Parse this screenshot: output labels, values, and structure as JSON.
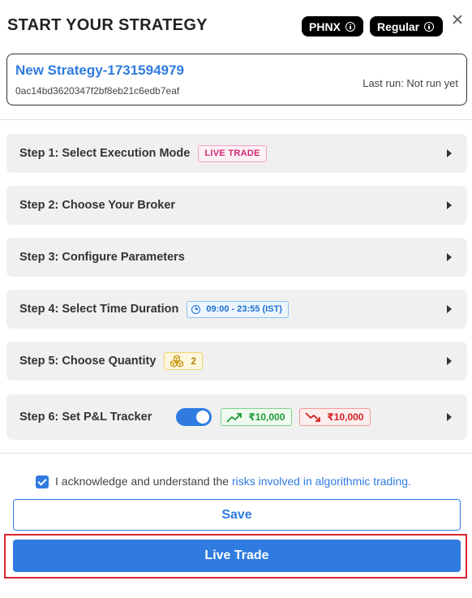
{
  "header": {
    "title": "START YOUR STRATEGY",
    "badges": [
      {
        "label": "PHNX",
        "icon": "info-icon"
      },
      {
        "label": "Regular",
        "icon": "info-icon"
      }
    ],
    "close_icon": "close-icon"
  },
  "strategy": {
    "name": "New Strategy-1731594979",
    "id": "0ac14bd3620347f2bf8eb21c6edb7eaf",
    "last_run": "Last run: Not run yet"
  },
  "steps": [
    {
      "label": "Step 1: Select Execution Mode",
      "tag": "LIVE TRADE"
    },
    {
      "label": "Step 2: Choose Your Broker"
    },
    {
      "label": "Step 3: Configure Parameters"
    },
    {
      "label": "Step 4: Select Time Duration",
      "tag": "09:00 - 23:55 (IST)",
      "tag_icon": "clock-icon"
    },
    {
      "label": "Step 5: Choose Quantity",
      "tag": "2",
      "tag_icon": "cubes-icon"
    },
    {
      "label": "Step 6: Set P&L Tracker",
      "toggle_on": true,
      "profit": "₹10,000",
      "loss": "₹10,000",
      "profit_icon": "trend-up-icon",
      "loss_icon": "trend-down-icon"
    }
  ],
  "acknowledge": {
    "checked": true,
    "text": "I acknowledge and understand the ",
    "link": "risks involved in algorithmic trading."
  },
  "buttons": {
    "save": "Save",
    "live_trade": "Live Trade"
  },
  "colors": {
    "accent": "#2f7be0",
    "highlight_outline": "#d9262b",
    "live_tag": "#d02770",
    "profit": "#1e9a35",
    "loss": "#d11f1f"
  }
}
